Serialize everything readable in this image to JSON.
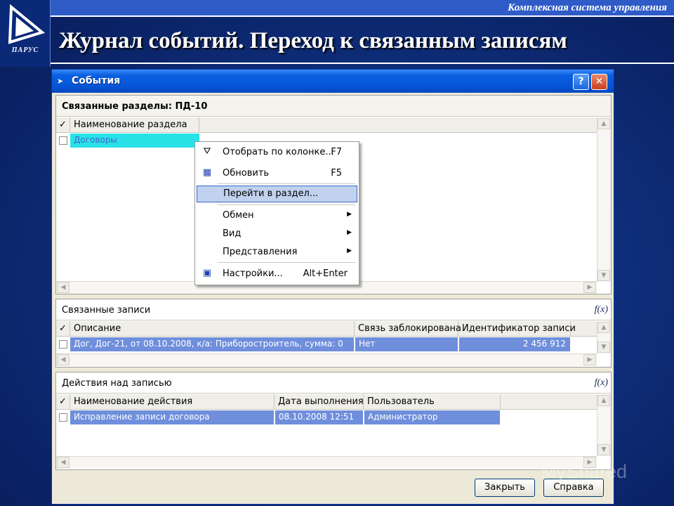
{
  "slide": {
    "top_bar_text": "Комплексная система управления",
    "title": "Журнал событий. Переход к связанным записям",
    "logo_text": "ПАРУС",
    "watermark": "MyShared"
  },
  "window": {
    "title": "События",
    "help_label": "?",
    "close_label": "✕"
  },
  "sections": {
    "related_sections": {
      "header": "Связанные разделы: ПД-10",
      "check_header": "✓",
      "columns": [
        "Наименование раздела"
      ],
      "rows": [
        [
          "Договоры"
        ]
      ]
    },
    "related_records": {
      "header": "Связанные записи",
      "check_header": "✓",
      "columns": [
        "Описание",
        "Связь заблокирована",
        "Идентификатор записи"
      ],
      "rows": [
        [
          "Дог, Дог-21, от 08.10.2008, к/а: Приборостроитель, сумма: 0",
          "Нет",
          "2 456 912"
        ]
      ]
    },
    "record_actions": {
      "header": "Действия над записью",
      "check_header": "✓",
      "columns": [
        "Наименование действия",
        "Дата выполнения",
        "Пользователь"
      ],
      "rows": [
        [
          "Исправление записи договора",
          "08.10.2008 12:51",
          "Администратор"
        ]
      ]
    }
  },
  "fx_label": "f(x)",
  "context_menu": {
    "items": [
      {
        "label": "Отобрать по колонке...",
        "shortcut": "F7",
        "icon": "filter-icon"
      },
      {
        "label": "Обновить",
        "shortcut": "F5",
        "icon": "refresh-icon"
      },
      {
        "label": "Перейти в раздел...",
        "highlighted": true
      },
      {
        "label": "Обмен",
        "submenu": true
      },
      {
        "label": "Вид",
        "submenu": true
      },
      {
        "label": "Представления",
        "submenu": true
      },
      {
        "label": "Настройки...",
        "shortcut": "Alt+Enter",
        "icon": "settings-icon"
      }
    ]
  },
  "buttons": {
    "close": "Закрыть",
    "help": "Справка"
  },
  "colors": {
    "selection_blue": "#6f8edc",
    "selection_cyan": "#27e3e8",
    "menu_highlight": "#c1d2ee",
    "titlebar_blue": "#0656d7"
  }
}
